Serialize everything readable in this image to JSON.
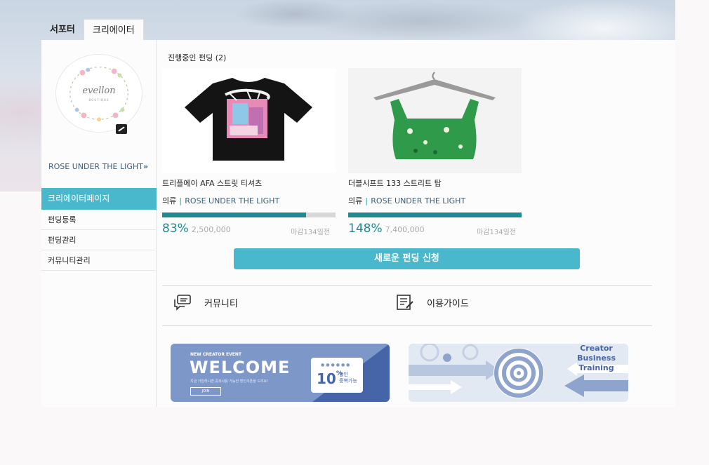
{
  "tabs": [
    "서포터",
    "크리에이터"
  ],
  "creator": {
    "name": "ROSE UNDER THE LIGHT",
    "name_arrow": "»",
    "logo_text": "evellon",
    "logo_sub": "BOUTIQUE"
  },
  "menu": {
    "header": "크리에이터페이지",
    "items": [
      "펀딩등록",
      "펀딩관리",
      "커뮤니티관리"
    ]
  },
  "section_title": "진행중인 펀딩 (2)",
  "fundings": [
    {
      "title": "트리플에이 AFA 스트릿 티셔츠",
      "category": "의류",
      "separator": "|",
      "brand": "ROSE UNDER THE LIGHT",
      "percent": "83%",
      "progress": 0.83,
      "amount": "2,500,000",
      "deadline": "마감134일전",
      "image": "black-tshirt"
    },
    {
      "title": "더블시프트 133 스트리트 탑",
      "category": "의류",
      "separator": "|",
      "brand": "ROSE UNDER THE LIGHT",
      "percent": "148%",
      "progress": 1.0,
      "amount": "7,400,000",
      "deadline": "마감134일전",
      "image": "green-floral-top"
    }
  ],
  "new_funding_button": "새로운 펀딩 신청",
  "links": {
    "community": "커뮤니티",
    "guide": "이용가이드"
  },
  "banners": {
    "welcome": {
      "eyebrow": "NEW CREATOR EVENT",
      "title": "WELCOME",
      "desc": "지금 가입하시면 중복사용 가능한 할인쿠폰을 드려요!",
      "join": "JOIN",
      "coupon_pct": "10",
      "coupon_unit": "%",
      "coupon_text_1": "할인",
      "coupon_text_2": "중복가능",
      "dots": "●●●●●●"
    },
    "training": {
      "line1": "Creator",
      "line2": "Business",
      "line3": "Training"
    }
  },
  "colors": {
    "accent": "#4ab8cc",
    "progress": "#1e8a93",
    "brand_text": "#3d5f7a"
  }
}
